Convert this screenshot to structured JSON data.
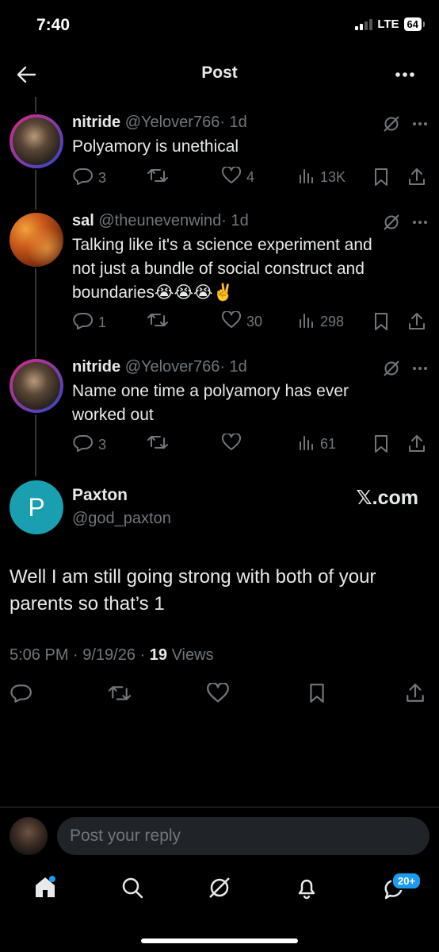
{
  "status_bar": {
    "time": "7:40",
    "network": "LTE",
    "battery": "64"
  },
  "header": {
    "title": "Post"
  },
  "thread": [
    {
      "name": "nitride",
      "handle": "@Yelover766",
      "age": "· 1d",
      "text": "Polyamory is unethical",
      "replies": "3",
      "reposts": "",
      "likes": "4",
      "views": "13K"
    },
    {
      "name": "sal",
      "handle": "@theunevenwind",
      "age": "· 1d",
      "text_lines": [
        "Talking like it's a science experiment and",
        "not just a bundle of social construct and",
        "boundaries😭😭😭✌️"
      ],
      "replies": "1",
      "reposts": "",
      "likes": "30",
      "views": "298"
    },
    {
      "name": "nitride",
      "handle": "@Yelover766",
      "age": "· 1d",
      "text_lines": [
        "Name one time a polyamory has ever",
        "worked out"
      ],
      "replies": "3",
      "reposts": "",
      "likes": "",
      "views": "61"
    }
  ],
  "main_post": {
    "avatar_letter": "P",
    "name": "Paxton",
    "handle": "@god_paxton",
    "watermark": "𝕏.com",
    "text_lines": [
      "Well I am still going strong with both of your",
      "parents so that’s 1"
    ],
    "time_date": "5:06 PM · 9/19/26 · ",
    "views_count": "19",
    "views_label": " Views"
  },
  "reply_box": {
    "placeholder": "Post your reply"
  },
  "bottom_nav": {
    "messages_badge": "20+"
  },
  "colors": {
    "background": "#000000",
    "text": "#e7e9ea",
    "muted": "#71767b",
    "accent": "#1d9bf0",
    "avatar_p": "#1a9fb0"
  }
}
